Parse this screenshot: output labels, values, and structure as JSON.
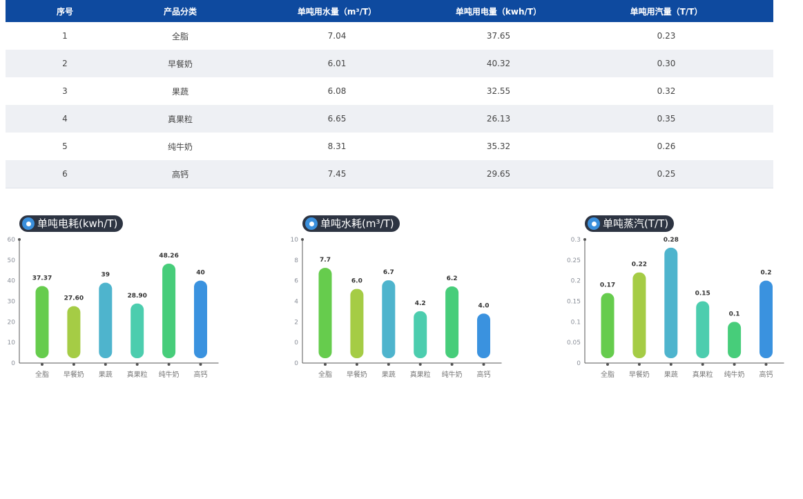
{
  "table": {
    "headers": [
      "序号",
      "产品分类",
      "单吨用水量（m³/T）",
      "单吨用电量（kwh/T）",
      "单吨用汽量（T/T）"
    ],
    "rows": [
      [
        "1",
        "全脂",
        "7.04",
        "37.65",
        "0.23"
      ],
      [
        "2",
        "早餐奶",
        "6.01",
        "40.32",
        "0.30"
      ],
      [
        "3",
        "果蔬",
        "6.08",
        "32.55",
        "0.32"
      ],
      [
        "4",
        "真果粒",
        "6.65",
        "26.13",
        "0.35"
      ],
      [
        "5",
        "纯牛奶",
        "8.31",
        "35.32",
        "0.26"
      ],
      [
        "6",
        "高钙",
        "7.45",
        "29.65",
        "0.25"
      ]
    ]
  },
  "colors": [
    "#66cc4d",
    "#a5cc45",
    "#4eb4cd",
    "#4ccdae",
    "#47cd7a",
    "#3a92df"
  ],
  "chart_data": [
    {
      "type": "bar",
      "title": "单吨电耗(kwh/T)",
      "categories": [
        "全脂",
        "早餐奶",
        "果蔬",
        "真果粒",
        "纯牛奶",
        "高钙"
      ],
      "values": [
        37.37,
        27.6,
        39,
        28.9,
        48.26,
        40
      ],
      "value_labels": [
        "37.37",
        "27.60",
        "39",
        "28.90",
        "48.26",
        "40"
      ],
      "yticks": [
        "0",
        "10",
        "20",
        "30",
        "40",
        "50",
        "60"
      ],
      "ylim": [
        0,
        60
      ],
      "grid": false,
      "legend": "none"
    },
    {
      "type": "bar",
      "title": "单吨水耗(m³/T)",
      "categories": [
        "全脂",
        "早餐奶",
        "果蔬",
        "真果粒",
        "纯牛奶",
        "高钙"
      ],
      "values": [
        7.7,
        6.0,
        6.7,
        4.2,
        6.2,
        4.0
      ],
      "value_labels": [
        "7.7",
        "6.0",
        "6.7",
        "4.2",
        "6.2",
        "4.0"
      ],
      "yticks": [
        "0",
        "0",
        "2",
        "4",
        "6",
        "8",
        "10"
      ],
      "ylim": [
        0,
        10
      ],
      "grid": false,
      "legend": "none"
    },
    {
      "type": "bar",
      "title": "单吨蒸汽(T/T)",
      "categories": [
        "全脂",
        "早餐奶",
        "果蔬",
        "真果粒",
        "纯牛奶",
        "高钙"
      ],
      "values": [
        0.17,
        0.22,
        0.28,
        0.15,
        0.1,
        0.2
      ],
      "value_labels": [
        "0.17",
        "0.22",
        "0.28",
        "0.15",
        "0.1",
        "0.2"
      ],
      "yticks": [
        "0",
        "0.05",
        "0.1",
        "0.15",
        "0.2",
        "0.25",
        "0.3"
      ],
      "ylim": [
        0,
        0.3
      ],
      "grid": false,
      "legend": "none"
    }
  ]
}
